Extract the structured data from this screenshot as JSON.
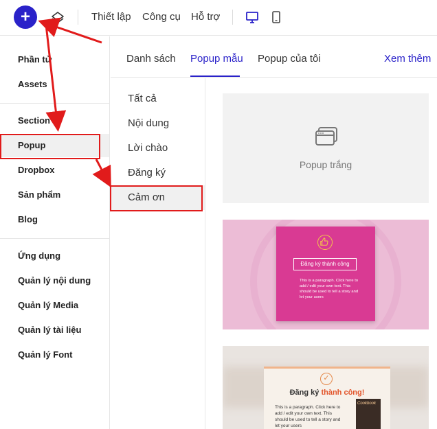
{
  "toolbar": {
    "add_icon": "plus-icon",
    "layers_icon": "layers-icon",
    "menu": [
      "Thiết lập",
      "Công cụ",
      "Hỗ trợ"
    ],
    "desktop_icon": "desktop-icon",
    "mobile_icon": "mobile-icon",
    "accent_color": "#2a22c9"
  },
  "sidebar": {
    "groups": [
      [
        "Phần tử",
        "Assets"
      ],
      [
        "Section",
        "Popup",
        "Dropbox",
        "Sản phẩm",
        "Blog"
      ],
      [
        "Ứng dụng",
        "Quản lý nội dung",
        "Quản lý Media",
        "Quản lý tài liệu",
        "Quản lý Font"
      ]
    ],
    "active": "Popup"
  },
  "tabs": {
    "items": [
      "Danh sách",
      "Popup mẫu",
      "Popup của tôi"
    ],
    "active": "Popup mẫu",
    "more": "Xem thêm"
  },
  "categories": {
    "items": [
      "Tất cả",
      "Nội dung",
      "Lời chào",
      "Đăng ký",
      "Cảm ơn"
    ],
    "active": "Cảm ơn"
  },
  "templates": {
    "blank": {
      "label": "Popup trắng",
      "icon": "browser-window-icon"
    },
    "pink": {
      "title": "Đăng ký thành công",
      "paragraph": "This is a paragraph. Click here to add / edit your own text. This should be used to tell a story and let your users",
      "icon": "thumbs-up-icon"
    },
    "food": {
      "title_prefix": "Đăng ký ",
      "title_highlight": "thành công!",
      "paragraph": "This is a paragraph. Click here to add / edit your own text. This should be used to tell a story and let your users",
      "book_title": "Cookbook",
      "icon": "check-circle-icon"
    }
  },
  "annotation": {
    "highlight_color": "#e11b1b"
  }
}
